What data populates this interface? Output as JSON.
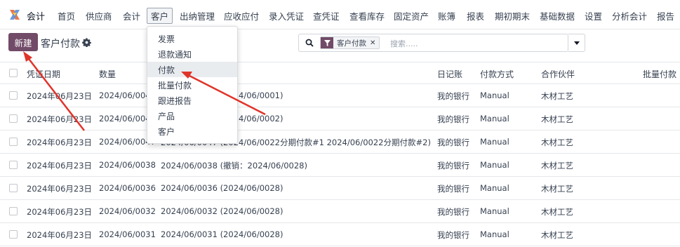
{
  "nav": {
    "app_name": "会计",
    "items": [
      "首页",
      "供应商",
      "会计",
      "客户",
      "出纳管理",
      "应收应付",
      "录入凭证",
      "查凭证",
      "查看库存",
      "固定资产",
      "账簿",
      "报表",
      "期初期末",
      "基础数据",
      "设置",
      "分析会计",
      "报告"
    ],
    "active": "客户"
  },
  "control": {
    "new_label": "新建",
    "title": "客户付款"
  },
  "search": {
    "facet_label": "客户付款",
    "facet_remove": "✕",
    "placeholder": "搜索....."
  },
  "dropdown": {
    "items": [
      "发票",
      "退款通知",
      "付款",
      "批量付款",
      "跟进报告",
      "产品",
      "客户"
    ],
    "highlighted": "付款"
  },
  "table": {
    "columns": [
      "凭证日期",
      "数量",
      "日记账",
      "付款方式",
      "合作伙伴",
      "批量付款"
    ],
    "rows": [
      {
        "date": "2024年06月23日",
        "number": "2024/06/0049",
        "memo": "2024/06/0049 (2024/06/0001)",
        "journal": "我的银行",
        "method": "Manual",
        "partner": "木材工艺"
      },
      {
        "date": "2024年06月23日",
        "number": "2024/06/0048",
        "memo": "2024/06/0048 (2024/06/0002)",
        "journal": "我的银行",
        "method": "Manual",
        "partner": "木材工艺"
      },
      {
        "date": "2024年06月23日",
        "number": "2024/06/0047",
        "memo": "2024/06/0047 (2024/06/0022分期付款#1 2024/06/0022分期付款#2)",
        "journal": "我的银行",
        "method": "Manual",
        "partner": "木材工艺"
      },
      {
        "date": "2024年06月23日",
        "number": "2024/06/0038",
        "memo": "2024/06/0038 (撤销：2024/06/0028)",
        "journal": "我的银行",
        "method": "Manual",
        "partner": "木材工艺"
      },
      {
        "date": "2024年06月23日",
        "number": "2024/06/0036",
        "memo": "2024/06/0036 (2024/06/0028)",
        "journal": "我的银行",
        "method": "Manual",
        "partner": "木材工艺"
      },
      {
        "date": "2024年06月23日",
        "number": "2024/06/0032",
        "memo": "2024/06/0032 (2024/06/0028)",
        "journal": "我的银行",
        "method": "Manual",
        "partner": "木材工艺"
      },
      {
        "date": "2024年06月23日",
        "number": "2024/06/0031",
        "memo": "2024/06/0031 (2024/06/0028)",
        "journal": "我的银行",
        "method": "Manual",
        "partner": "木材工艺"
      }
    ]
  },
  "colors": {
    "brand": "#714B67",
    "annotation_arrow": "#e0342a"
  },
  "icons": [
    "app-logo-icon",
    "gear-icon",
    "search-icon",
    "filter-icon",
    "caret-down-icon"
  ]
}
